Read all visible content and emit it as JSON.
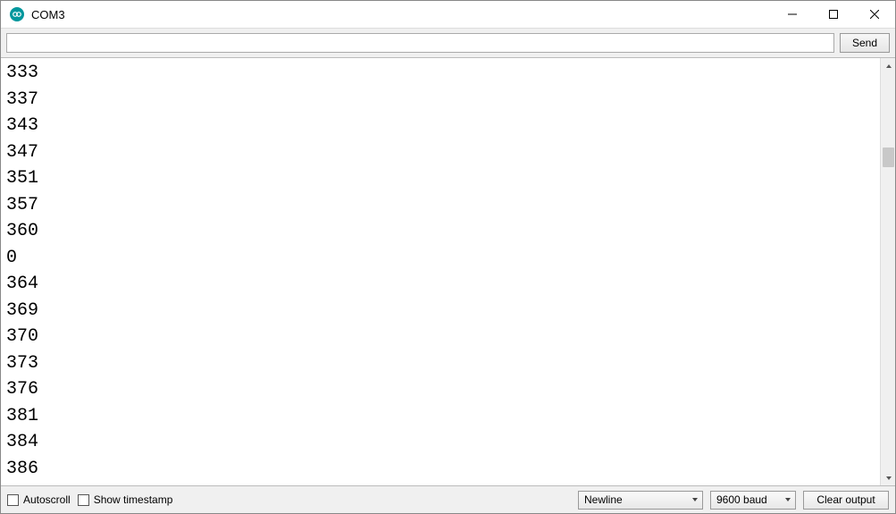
{
  "titlebar": {
    "title": "COM3"
  },
  "input_row": {
    "value": "",
    "placeholder": "",
    "send_label": "Send"
  },
  "output_lines": [
    "333",
    "337",
    "343",
    "347",
    "351",
    "357",
    "360",
    "0",
    "364",
    "369",
    "370",
    "373",
    "376",
    "381",
    "384",
    "386"
  ],
  "statusbar": {
    "autoscroll_label": "Autoscroll",
    "autoscroll_checked": false,
    "timestamp_label": "Show timestamp",
    "timestamp_checked": false,
    "line_ending_selected": "Newline",
    "baud_selected": "9600 baud",
    "clear_label": "Clear output"
  }
}
